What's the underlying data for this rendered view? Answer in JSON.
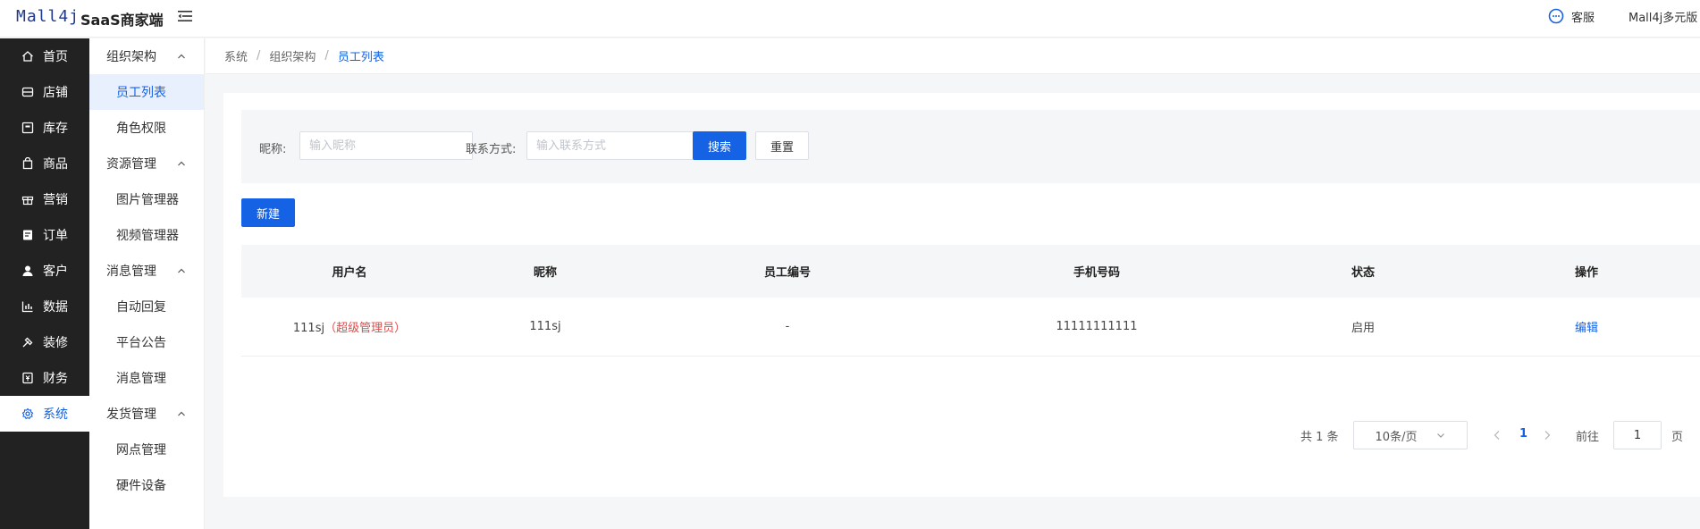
{
  "brand": {
    "logo": "Mall4j",
    "title": "SaaS商家端"
  },
  "header": {
    "service_label": "客服",
    "account_label": "Mall4j多元版"
  },
  "primary_nav": [
    {
      "label": "首页",
      "icon": "home-icon"
    },
    {
      "label": "店铺",
      "icon": "store-icon"
    },
    {
      "label": "库存",
      "icon": "inventory-icon"
    },
    {
      "label": "商品",
      "icon": "product-icon"
    },
    {
      "label": "营销",
      "icon": "gift-icon"
    },
    {
      "label": "订单",
      "icon": "order-icon"
    },
    {
      "label": "客户",
      "icon": "user-icon"
    },
    {
      "label": "数据",
      "icon": "chart-icon"
    },
    {
      "label": "装修",
      "icon": "decor-icon"
    },
    {
      "label": "财务",
      "icon": "finance-icon"
    },
    {
      "label": "系统",
      "icon": "gear-icon",
      "active": true
    }
  ],
  "secondary_nav": [
    {
      "group": "组织架构",
      "items": [
        "员工列表",
        "角色权限"
      ]
    },
    {
      "group": "资源管理",
      "items": [
        "图片管理器",
        "视频管理器"
      ]
    },
    {
      "group": "消息管理",
      "items": [
        "自动回复",
        "平台公告",
        "消息管理"
      ]
    },
    {
      "group": "发货管理",
      "items": [
        "网点管理",
        "硬件设备"
      ]
    }
  ],
  "breadcrumb": [
    "系统",
    "组织架构",
    "员工列表"
  ],
  "filters": {
    "nickname_label": "昵称:",
    "nickname_placeholder": "输入昵称",
    "nickname_value": "",
    "contact_label": "联系方式:",
    "contact_placeholder": "输入联系方式",
    "contact_value": "",
    "search_label": "搜索",
    "reset_label": "重置"
  },
  "new_button": "新建",
  "table": {
    "columns": [
      "用户名",
      "昵称",
      "员工编号",
      "手机号码",
      "状态",
      "操作"
    ],
    "rows": [
      {
        "username": "111sj",
        "role_tag": "（超级管理员）",
        "nickname": "111sj",
        "employee_no": "-",
        "phone": "11111111111",
        "status": "启用",
        "action": "编辑"
      }
    ]
  },
  "pagination": {
    "total": "共 1 条",
    "page_size": "10条/页",
    "current": "1",
    "goto_label": "前往",
    "goto_value": "1",
    "page_suffix": "页"
  },
  "colors": {
    "accent": "#1662e5",
    "sidebar_bg": "#222222",
    "admin_tag": "#e24a4a"
  }
}
